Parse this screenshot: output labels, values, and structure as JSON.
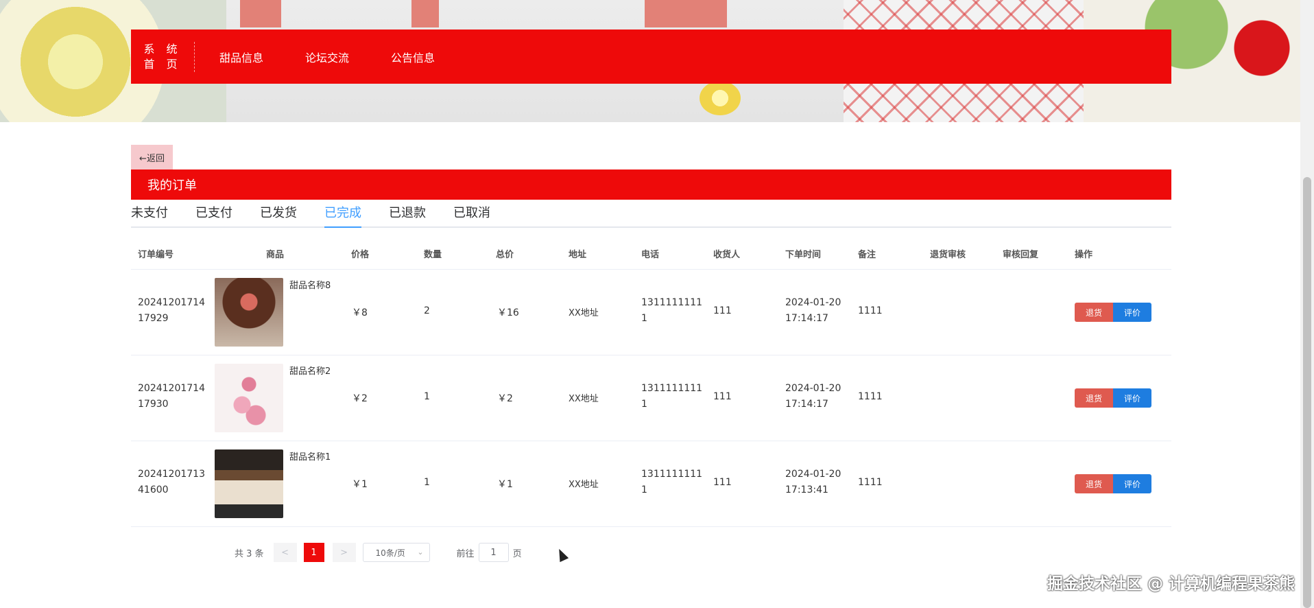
{
  "nav": {
    "home_line1": "系 统",
    "home_line2": "首 页",
    "items": [
      "甜品信息",
      "论坛交流",
      "公告信息"
    ]
  },
  "back": {
    "label": "←返回"
  },
  "page_title": "我的订单",
  "tabs": [
    "未支付",
    "已支付",
    "已发货",
    "已完成",
    "已退款",
    "已取消"
  ],
  "active_tab": "已完成",
  "table": {
    "headers": [
      "订单编号",
      "商品",
      "价格",
      "数量",
      "总价",
      "地址",
      "电话",
      "收货人",
      "下单时间",
      "备注",
      "退货审核",
      "审核回复",
      "操作"
    ],
    "rows": [
      {
        "order_no": "2024120171417929",
        "order_line1": "20241201714",
        "order_line2": "17929",
        "product": "甜品名称8",
        "price": "￥8",
        "qty": "2",
        "total": "￥16",
        "address": "XX地址",
        "phone_line1": "1311111111",
        "phone_line2": "1",
        "receiver": "111",
        "date": "2024-01-20",
        "time": "17:14:17",
        "note": "1111",
        "return_audit": "",
        "audit_reply": "",
        "thumb": "chocolate-cake"
      },
      {
        "order_no": "2024120171417930",
        "order_line1": "20241201714",
        "order_line2": "17930",
        "product": "甜品名称2",
        "price": "￥2",
        "qty": "1",
        "total": "￥2",
        "address": "XX地址",
        "phone_line1": "1311111111",
        "phone_line2": "1",
        "receiver": "111",
        "date": "2024-01-20",
        "time": "17:14:17",
        "note": "1111",
        "return_audit": "",
        "audit_reply": "",
        "thumb": "rose-cake"
      },
      {
        "order_no": "2024120171341600",
        "order_line1": "20241201713",
        "order_line2": "41600",
        "product": "甜品名称1",
        "price": "￥1",
        "qty": "1",
        "total": "￥1",
        "address": "XX地址",
        "phone_line1": "1311111111",
        "phone_line2": "1",
        "receiver": "111",
        "date": "2024-01-20",
        "time": "17:13:41",
        "note": "1111",
        "return_audit": "",
        "audit_reply": "",
        "thumb": "layered-cake"
      }
    ],
    "actions": {
      "return": "退货",
      "review": "评价"
    }
  },
  "pagination": {
    "total": "共 3 条",
    "prev": "<",
    "next": ">",
    "current": "1",
    "page_size": "10条/页",
    "goto_prefix": "前往",
    "goto_value": "1",
    "goto_suffix": "页"
  },
  "watermark": "掘金技术社区 @ 计算机编程果茶熊",
  "colors": {
    "brand_red": "#ee0a0a",
    "tab_active": "#409eff",
    "return_btn": "#df5a4f",
    "review_btn": "#1e7de0"
  }
}
